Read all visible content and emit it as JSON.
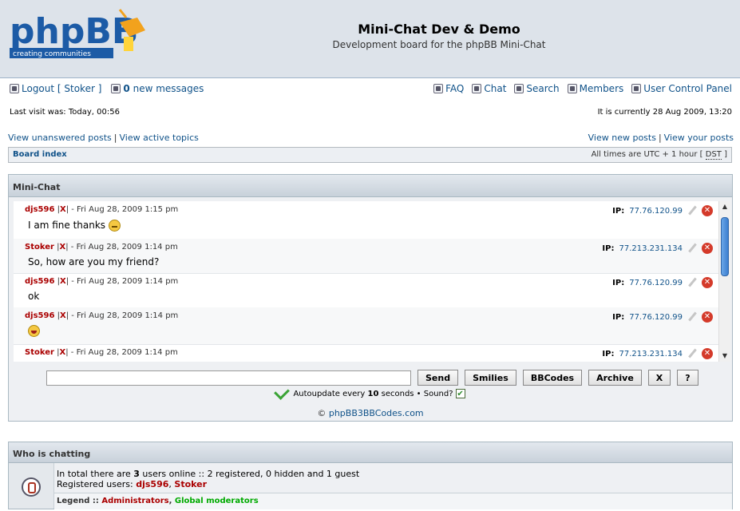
{
  "header": {
    "logo_text": "phpBB",
    "logo_tagline": "creating communities",
    "title": "Mini-Chat Dev & Demo",
    "description": "Development board for the phpBB Mini-Chat"
  },
  "nav": {
    "logout": "Logout [ Stoker ]",
    "new_messages_count": "0",
    "new_messages_label": "new messages",
    "faq": "FAQ",
    "chat": "Chat",
    "search": "Search",
    "members": "Members",
    "ucp": "User Control Panel"
  },
  "info": {
    "last_visit": "Last visit was: Today, 00:56",
    "current_time": "It is currently 28 Aug 2009, 13:20"
  },
  "links": {
    "unanswered": "View unanswered posts",
    "active": "View active topics",
    "new_posts": "View new posts",
    "your_posts": "View your posts"
  },
  "breadcrumb": {
    "board_index": "Board index",
    "timezone_prefix": "All times are UTC + 1 hour [",
    "dst": "DST",
    "timezone_suffix": "]"
  },
  "minichat": {
    "title": "Mini-Chat",
    "ip_label": "IP:",
    "delete_mark": "X",
    "messages": [
      {
        "user": "djs596",
        "date": "Fri Aug 28, 2009 1:15 pm",
        "text": "I am fine thanks",
        "smiley": "neutral",
        "ip": "77.76.120.99"
      },
      {
        "user": "Stoker",
        "date": "Fri Aug 28, 2009 1:14 pm",
        "text": "So, how are you my friend?",
        "smiley": "",
        "ip": "77.213.231.134"
      },
      {
        "user": "djs596",
        "date": "Fri Aug 28, 2009 1:14 pm",
        "text": "ok",
        "smiley": "",
        "ip": "77.76.120.99"
      },
      {
        "user": "djs596",
        "date": "Fri Aug 28, 2009 1:14 pm",
        "text": "",
        "smiley": "laugh",
        "ip": "77.76.120.99"
      },
      {
        "user": "Stoker",
        "date": "Fri Aug 28, 2009 1:14 pm",
        "text": "",
        "smiley": "",
        "ip": "77.213.231.134"
      }
    ],
    "input_value": "",
    "buttons": {
      "send": "Send",
      "smilies": "Smilies",
      "bbcodes": "BBCodes",
      "archive": "Archive",
      "close": "X",
      "help": "?"
    },
    "autoupdate_prefix": "Autoupdate every",
    "autoupdate_seconds": "10",
    "autoupdate_suffix": "seconds • Sound?",
    "sound_checked": true,
    "copyright_symbol": "©",
    "copyright_link": "phpBB3BBCodes.com"
  },
  "who": {
    "title": "Who is chatting",
    "total_prefix": "In total there are",
    "total_count": "3",
    "total_suffix": "users online :: 2 registered, 0 hidden and 1 guest",
    "registered_label": "Registered users:",
    "registered_users": [
      "djs596",
      "Stoker"
    ],
    "legend_label": "Legend ::",
    "legend_admins": "Administrators",
    "legend_gmods": "Global moderators"
  },
  "colors": {
    "header_bg": "#dde3ea",
    "link": "#105289",
    "username": "#aa0000",
    "moderator": "#00aa00"
  }
}
